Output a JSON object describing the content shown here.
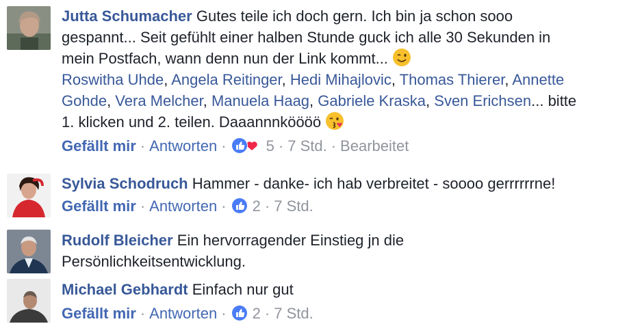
{
  "comments": [
    {
      "author": "Jutta Schumacher",
      "text_line1": "Gutes teile ich doch gern. Ich bin ja schon sooo",
      "text_line2": "gespannt... Seit gefühlt einer halben Stunde guck ich alle 30 Sekunden in",
      "text_line3": "mein Postfach, wann denn nun der Link kommt...",
      "tags": [
        "Roswitha Uhde",
        "Angela Reitinger",
        "Hedi Mihajlovic",
        "Thomas Thierer",
        "Annette",
        "Gohde",
        "Vera Melcher",
        "Manuela Haag",
        "Gabriele Kraska",
        "Sven Erichsen"
      ],
      "tag_suffix": "... bitte",
      "text_line6": "1. klicken und 2. teilen. Daaannnköööö",
      "like_label": "Gefällt mir",
      "reply_label": "Antworten",
      "reaction_count": "5",
      "time": "7 Std.",
      "edited": "Bearbeitet",
      "emoji1": "wink-emoji",
      "emoji2": "kiss-emoji"
    },
    {
      "author": "Sylvia Schodruch",
      "text": "Hammer - danke- ich hab verbreitet - soooo gerrrrrrne!",
      "like_label": "Gefällt mir",
      "reply_label": "Antworten",
      "reaction_count": "2",
      "time": "7 Std."
    },
    {
      "author": "Rudolf Bleicher",
      "text_line1": "Ein hervorragender Einstieg jn die",
      "text_line2": "Persönlichkeitsentwicklung."
    },
    {
      "author": "Michael Gebhardt",
      "text": "Einfach nur gut",
      "like_label": "Gefällt mir",
      "reply_label": "Antworten",
      "reaction_count": "2",
      "time": "7 Std."
    }
  ],
  "colors": {
    "link": "#385898",
    "action": "#4267b2",
    "meta": "#90949c",
    "like_blue": "#4a7cf6",
    "love_red": "#f0284a"
  }
}
